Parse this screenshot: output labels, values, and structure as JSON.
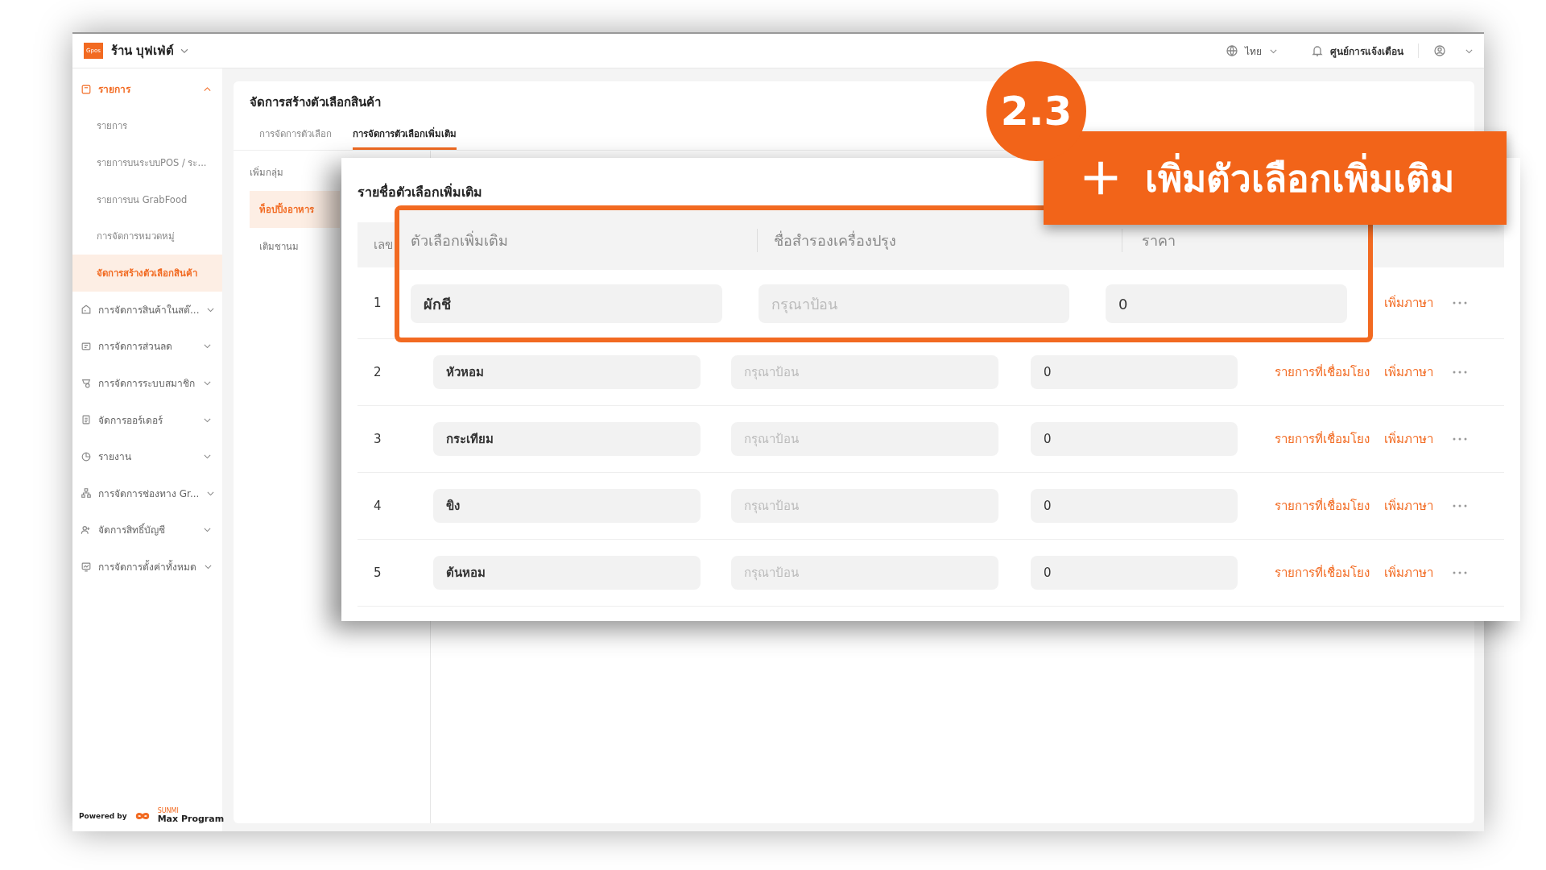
{
  "app": {
    "logo": "Gpos",
    "store_name": "ร้าน บุฟเฟ่ต์",
    "language": "ไทย",
    "notifications": "ศูนย์การแจ้งเตือน"
  },
  "sidebar": {
    "items": [
      {
        "label": "รายการ",
        "expanded": true,
        "children": [
          {
            "label": "รายการ",
            "selected": false
          },
          {
            "label": "รายการบนระบบPOS / ระ...",
            "selected": false
          },
          {
            "label": "รายการบน GrabFood",
            "selected": false
          },
          {
            "label": "การจัดการหมวดหมู่",
            "selected": false
          },
          {
            "label": "จัดการสร้างตัวเลือกสินค้า",
            "selected": true
          }
        ]
      },
      {
        "label": "การจัดการสินค้าในสต๊...",
        "expanded": false
      },
      {
        "label": "การจัดการส่วนลด",
        "expanded": false
      },
      {
        "label": "การจัดการระบบสมาชิก",
        "expanded": false
      },
      {
        "label": "จัดการออร์เดอร์",
        "expanded": false
      },
      {
        "label": "รายงาน",
        "expanded": false
      },
      {
        "label": "การจัดการช่องทาง Gr...",
        "expanded": false
      },
      {
        "label": "จัดการสิทธิ์บัญชี",
        "expanded": false
      },
      {
        "label": "การจัดการตั้งค่าทั้งหมด",
        "expanded": false
      }
    ],
    "footer": {
      "powered_by": "Powered by",
      "brand_small": "SUNMI",
      "brand": "Max Program"
    }
  },
  "page": {
    "title": "จัดการสร้างตัวเลือกสินค้า",
    "tabs": [
      {
        "label": "การจัดการตัวเลือก",
        "selected": false
      },
      {
        "label": "การจัดการตัวเลือกเพิ่มเติม",
        "selected": true
      }
    ],
    "add_group": "เพิ่มกลุ่ม",
    "groups": [
      {
        "label": "ท็อปปิ้งอาหาร",
        "selected": true
      },
      {
        "label": "เติมชานม",
        "selected": false
      }
    ]
  },
  "panel": {
    "title": "รายชื่อตัวเลือกเพิ่มเติม",
    "number_column": "เลข",
    "columns": [
      "ตัวเลือกเพิ่มเติม",
      "ชื่อสำรองเครื่องปรุง",
      "ราคา"
    ],
    "rows": [
      {
        "number": "1",
        "name": "ผักชี",
        "alt_placeholder": "กรุณาป้อน",
        "price": "0",
        "links": [
          "เพิ่มภาษา"
        ],
        "highlighted": true
      },
      {
        "number": "2",
        "name": "หัวหอม",
        "alt_placeholder": "กรุณาป้อน",
        "price": "0",
        "links": [
          "รายการที่เชื่อมโยง",
          "เพิ่มภาษา"
        ],
        "highlighted": false
      },
      {
        "number": "3",
        "name": "กระเทียม",
        "alt_placeholder": "กรุณาป้อน",
        "price": "0",
        "links": [
          "รายการที่เชื่อมโยง",
          "เพิ่มภาษา"
        ],
        "highlighted": false
      },
      {
        "number": "4",
        "name": "ขิง",
        "alt_placeholder": "กรุณาป้อน",
        "price": "0",
        "links": [
          "รายการที่เชื่อมโยง",
          "เพิ่มภาษา"
        ],
        "highlighted": false
      },
      {
        "number": "5",
        "name": "ต้นหอม",
        "alt_placeholder": "กรุณาป้อน",
        "price": "0",
        "links": [
          "รายการที่เชื่อมโยง",
          "เพิ่มภาษา"
        ],
        "highlighted": false
      }
    ]
  },
  "annotation": {
    "step": "2.3",
    "banner": "เพิ่มตัวเลือกเพิ่มเติม"
  }
}
